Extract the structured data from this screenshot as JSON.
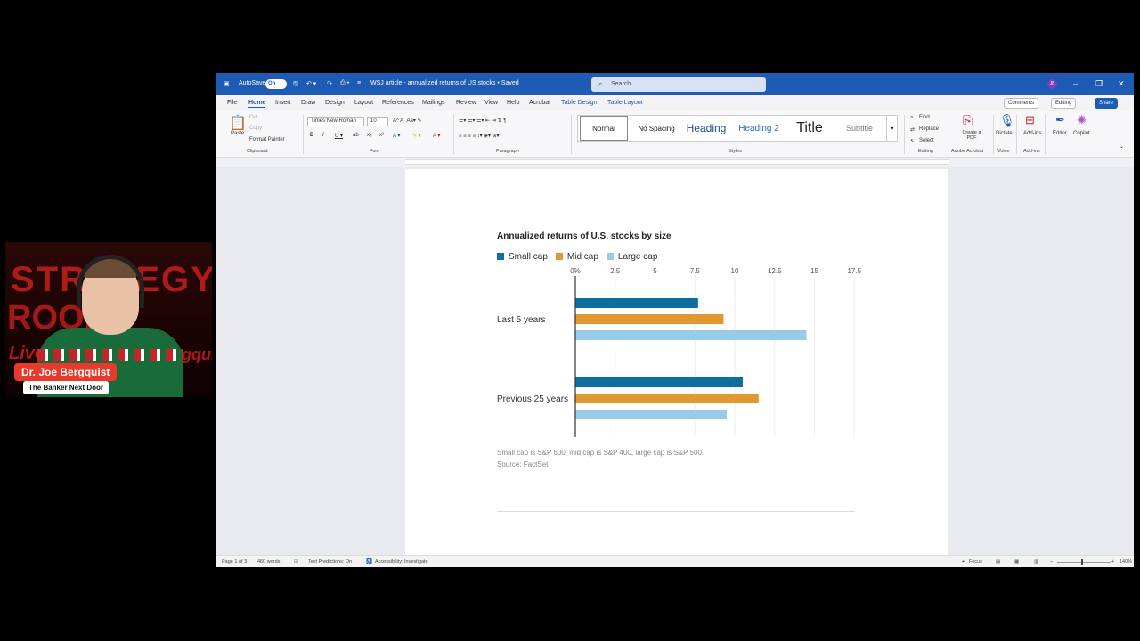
{
  "webcam": {
    "name": "Dr. Joe Bergquist",
    "subtitle": "The Banker Next Door",
    "backdrop_top": "STRATEGY",
    "backdrop_mid": "ROOM",
    "backdrop_left": "Live",
    "backdrop_right": "Bergquist"
  },
  "titlebar": {
    "autosave": "AutoSave",
    "autosave_state": "On",
    "doc_title": "WSJ article - annualized returns of US stocks • Saved",
    "search_placeholder": "Search",
    "avatar": "JB"
  },
  "menu": [
    "File",
    "Home",
    "Insert",
    "Draw",
    "Design",
    "Layout",
    "References",
    "Mailings",
    "Review",
    "View",
    "Help",
    "Acrobat",
    "Table Design",
    "Table Layout"
  ],
  "menu_right": {
    "comments": "Comments",
    "editing": "Editing",
    "share": "Share"
  },
  "ribbon": {
    "paste": "Paste",
    "cut": "Cut",
    "copy": "Copy",
    "format_painter": "Format Painter",
    "clipboard": "Clipboard",
    "font_name": "Times New Roman",
    "font_size": "10",
    "font_group": "Font",
    "paragraph_group": "Paragraph",
    "styles": [
      "Normal",
      "No Spacing",
      "Heading",
      "Heading 2",
      "Title",
      "Subtitle"
    ],
    "styles_group": "Styles",
    "find": "Find",
    "replace": "Replace",
    "select": "Select",
    "editing_group": "Editing",
    "create_pdf": "Create a PDF",
    "adobe_group": "Adobe Acrobat",
    "dictate": "Dictate",
    "voice_group": "Voice",
    "addins": "Add-ins",
    "addins_group": "Add-ins",
    "editor": "Editor",
    "copilot": "Copilot"
  },
  "status": {
    "page": "Page 1 of 3",
    "words": "460 words",
    "text_predictions": "Text Predictions: On",
    "accessibility": "Accessibility: Investigate",
    "focus": "Focus",
    "zoom": "140%"
  },
  "doc": {
    "note1": "Small cap is S&P 600, mid cap is S&P 400, large cap is S&P 500.",
    "note2": "Source: FactSet"
  },
  "colors": {
    "small_cap": "#0f6ea0",
    "mid_cap": "#e1982f",
    "large_cap": "#98cbe8",
    "word_blue": "#1d5bb5"
  },
  "chart_data": {
    "type": "bar",
    "orientation": "horizontal",
    "title": "Annualized returns of U.S. stocks by size",
    "categories": [
      "Last 5 years",
      "Previous 25 years"
    ],
    "series": [
      {
        "name": "Small cap",
        "values": [
          7.7,
          10.5
        ]
      },
      {
        "name": "Mid cap",
        "values": [
          9.3,
          11.5
        ]
      },
      {
        "name": "Large cap",
        "values": [
          14.5,
          9.5
        ]
      }
    ],
    "x_ticks": [
      "0%",
      "2.5",
      "5",
      "7.5",
      "10",
      "12.5",
      "15",
      "17.5"
    ],
    "xlim": [
      0,
      17.5
    ],
    "legend": "top-left",
    "grid": true
  }
}
